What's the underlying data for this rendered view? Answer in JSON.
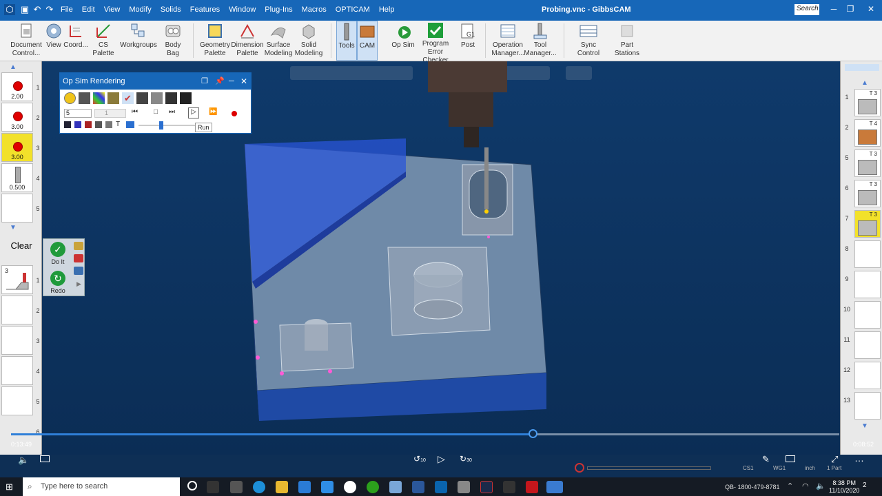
{
  "titlebar": {
    "menu": [
      "File",
      "Edit",
      "View",
      "Modify",
      "Solids",
      "Features",
      "Window",
      "Plug-Ins",
      "Macros",
      "OPTICAM",
      "Help"
    ],
    "window_title": "Probing.vnc - GibbsCAM",
    "search_placeholder": "Search"
  },
  "ribbon": {
    "buttons": [
      {
        "label1": "Document",
        "label2": "Control..."
      },
      {
        "label1": "View",
        "label2": ""
      },
      {
        "label1": "Coord...",
        "label2": ""
      },
      {
        "label1": "CS Palette",
        "label2": ""
      },
      {
        "label1": "Workgroups",
        "label2": ""
      },
      {
        "label1": "Body Bag",
        "label2": ""
      },
      {
        "label1": "Geometry",
        "label2": "Palette"
      },
      {
        "label1": "Dimension",
        "label2": "Palette"
      },
      {
        "label1": "Surface",
        "label2": "Modeling"
      },
      {
        "label1": "Solid",
        "label2": "Modeling"
      },
      {
        "label1": "Tools",
        "label2": ""
      },
      {
        "label1": "CAM",
        "label2": ""
      },
      {
        "label1": "Op Sim",
        "label2": ""
      },
      {
        "label1": "Program Error",
        "label2": "Checker"
      },
      {
        "label1": "Post",
        "label2": ""
      },
      {
        "label1": "Operation",
        "label2": "Manager..."
      },
      {
        "label1": "Tool",
        "label2": "Manager..."
      },
      {
        "label1": "Sync Control",
        "label2": ""
      },
      {
        "label1": "Part Stations",
        "label2": ""
      }
    ]
  },
  "tools": [
    {
      "num": "1",
      "value": "2.00"
    },
    {
      "num": "2",
      "value": "3.00"
    },
    {
      "num": "3",
      "value": "3.00"
    },
    {
      "num": "4",
      "value": "0.500"
    },
    {
      "num": "5",
      "value": ""
    }
  ],
  "clear_label": "Clear",
  "doit": {
    "do_label": "Do It",
    "redo_label": "Redo"
  },
  "ops_left": [
    {
      "num": "1",
      "tool": "3"
    },
    {
      "num": "2",
      "tool": ""
    },
    {
      "num": "3",
      "tool": ""
    },
    {
      "num": "4",
      "tool": ""
    },
    {
      "num": "5",
      "tool": ""
    },
    {
      "num": "6",
      "tool": ""
    }
  ],
  "ops_right": [
    {
      "num": "1",
      "tool": "T 3"
    },
    {
      "num": "2",
      "tool": "T 4"
    },
    {
      "num": "5",
      "tool": "T 3"
    },
    {
      "num": "6",
      "tool": "T 3"
    },
    {
      "num": "7",
      "tool": "T 3"
    },
    {
      "num": "8",
      "tool": ""
    },
    {
      "num": "9",
      "tool": ""
    },
    {
      "num": "10",
      "tool": ""
    },
    {
      "num": "11",
      "tool": ""
    },
    {
      "num": "12",
      "tool": ""
    },
    {
      "num": "13",
      "tool": ""
    }
  ],
  "opsim": {
    "title": "Op Sim Rendering",
    "step_value": "5",
    "step_value2": "1",
    "tooltip": "Run"
  },
  "player": {
    "elapsed": "0:13:49",
    "remaining": "0:08:52",
    "skip_back": "10",
    "skip_fwd": "30",
    "progress": 0.63
  },
  "statusbar": {
    "cs": "CS1",
    "wg": "WG1",
    "units": "inch",
    "part": "1 Part"
  },
  "taskbar": {
    "search_placeholder": "Type here to search",
    "tray_text": "QB- 1800-479-8781",
    "time": "8:38 PM",
    "date": "11/10/2020",
    "notif_count": "2"
  }
}
